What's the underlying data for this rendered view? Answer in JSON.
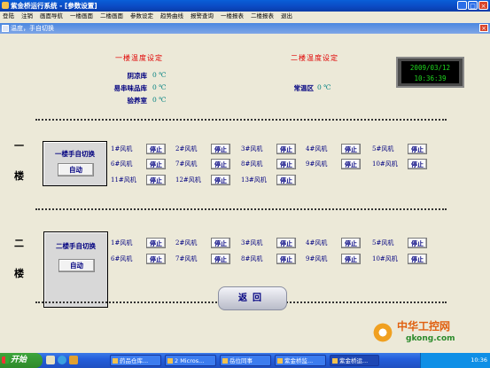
{
  "window": {
    "title": "紫金桥运行系统 - [参数设置]"
  },
  "menu": [
    "登陆",
    "注销",
    "画面导航",
    "一楼画面",
    "二楼画面",
    "参数设定",
    "趋势曲线",
    "报警查询",
    "一楼报表",
    "二楼报表",
    "退出"
  ],
  "panel": {
    "title": "温度，手自切换"
  },
  "floor1_temp": {
    "heading": "一楼温度设定",
    "rows": [
      {
        "label": "阴凉库",
        "value": "0 ℃"
      },
      {
        "label": "易串味品库",
        "value": "0 ℃"
      },
      {
        "label": "验养室",
        "value": "0 ℃"
      }
    ]
  },
  "floor2_temp": {
    "heading": "二楼温度设定",
    "rows": [
      {
        "label": "常温区",
        "value": "0 ℃"
      }
    ]
  },
  "clock": {
    "date": "2009/03/12",
    "time": "10:36:39"
  },
  "floor1": {
    "label": "一\n楼",
    "char1": "一",
    "char2": "楼",
    "switch_label": "一楼手自切换",
    "switch_button": "自动",
    "fans": [
      "1#风机",
      "2#风机",
      "3#风机",
      "4#风机",
      "5#风机",
      "6#风机",
      "7#风机",
      "8#风机",
      "9#风机",
      "10#风机",
      "11#风机",
      "12#风机",
      "13#风机"
    ],
    "stop_label": "停止"
  },
  "floor2": {
    "char1": "二",
    "char2": "楼",
    "switch_label": "二楼手自切换",
    "switch_button": "自动",
    "fans": [
      "1#风机",
      "2#风机",
      "3#风机",
      "4#风机",
      "5#风机",
      "6#风机",
      "7#风机",
      "8#风机",
      "9#风机",
      "10#风机"
    ],
    "stop_label": "停止"
  },
  "back_button": "返回",
  "taskbar": {
    "start": "开始",
    "tasks": [
      "药品仓库...",
      "2 Micros...",
      "岳位同事",
      "紫金桥监...",
      "紫金桥运..."
    ],
    "time": "10:36"
  },
  "watermark": {
    "brand": "中华工控网",
    "url": "gkong.com"
  }
}
